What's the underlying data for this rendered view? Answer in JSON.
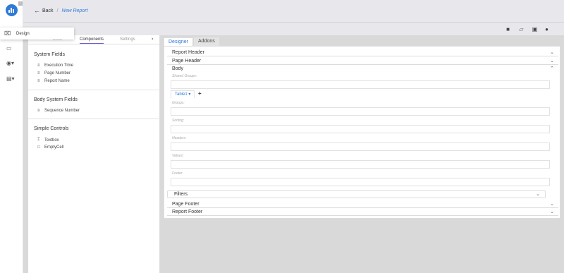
{
  "rail": {
    "icons": [
      "logo-icon",
      "folder-icon",
      "user-icon",
      "id-card-icon"
    ]
  },
  "design_popup": {
    "label": "Design",
    "icon": "design-icon"
  },
  "header": {
    "back_label": "Back",
    "separator": "/",
    "current": "New Report"
  },
  "toolbar": {
    "icons": [
      "note-icon",
      "open-folder-icon",
      "save-icon",
      "play-icon"
    ]
  },
  "components_panel": {
    "tabs": [
      {
        "label": "Data"
      },
      {
        "label": "Components",
        "active": true
      },
      {
        "label": "Settings"
      }
    ],
    "sections": [
      {
        "title": "System Fields",
        "items": [
          "Execution Time",
          "Page Number",
          "Report Name"
        ]
      },
      {
        "title": "Body System Fields",
        "items": [
          "Sequence Number"
        ]
      },
      {
        "title": "Simple Controls",
        "items": [
          "Textbox",
          "EmptyCell"
        ]
      }
    ]
  },
  "designer": {
    "tabs": [
      {
        "label": "Designer",
        "active": true
      },
      {
        "label": "Addons"
      }
    ],
    "sections": {
      "report_header": "Report Header",
      "page_header": "Page Header",
      "body": "Body",
      "page_footer": "Page Footer",
      "report_footer": "Report Footer"
    },
    "shared_groups_label": "Shared Groups:",
    "table_tab": "Table1",
    "add_label": "+",
    "fields": {
      "groups": "Groups:",
      "sorting": "Sorting:",
      "headers": "Headers:",
      "values": "Values:",
      "footer": "Footer:"
    },
    "filters_label": "Filters"
  },
  "colors": {
    "accent": "#2f7ad6",
    "tab_underline": "#6a5acd"
  }
}
